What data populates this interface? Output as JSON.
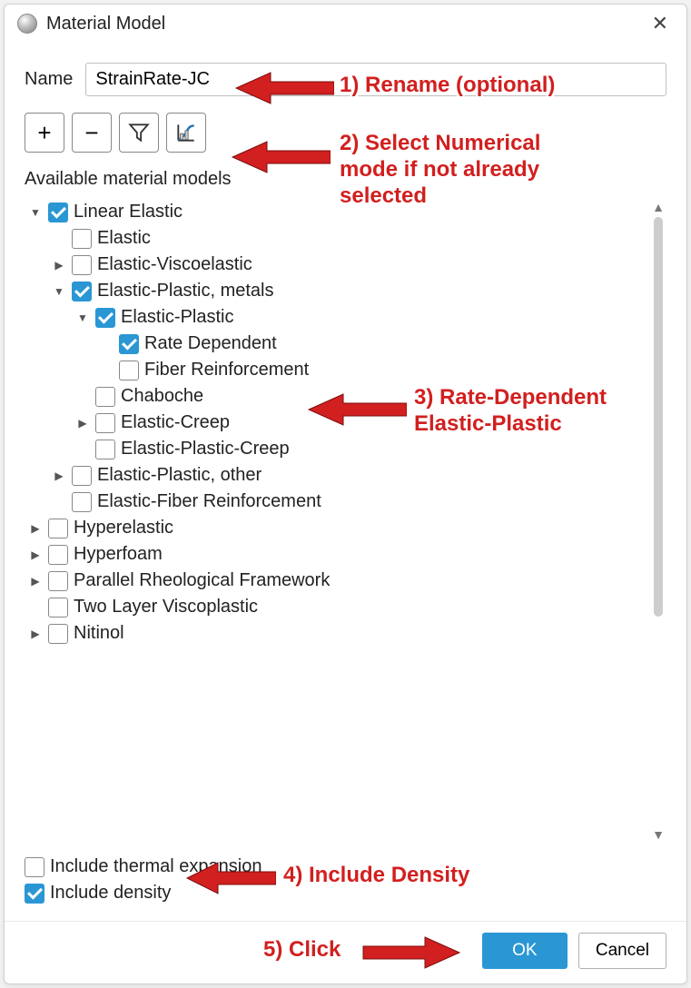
{
  "window": {
    "title": "Material Model",
    "close_icon": "close-icon"
  },
  "name_row": {
    "label": "Name",
    "value": "StrainRate-JC"
  },
  "toolbar": {
    "add": "+",
    "remove": "−",
    "filter_icon": "filter-icon",
    "chart_icon": "numerical-mode-icon"
  },
  "section_label": "Available material models",
  "tree": {
    "items": [
      {
        "d": 0,
        "caret": "down",
        "checked": true,
        "label": "Linear Elastic"
      },
      {
        "d": 1,
        "caret": null,
        "checked": false,
        "label": "Elastic"
      },
      {
        "d": 1,
        "caret": "right",
        "checked": false,
        "label": "Elastic-Viscoelastic"
      },
      {
        "d": 1,
        "caret": "down",
        "checked": true,
        "label": "Elastic-Plastic, metals"
      },
      {
        "d": 2,
        "caret": "down",
        "checked": true,
        "label": "Elastic-Plastic"
      },
      {
        "d": 3,
        "caret": null,
        "checked": true,
        "label": "Rate Dependent"
      },
      {
        "d": 3,
        "caret": null,
        "checked": false,
        "label": "Fiber Reinforcement"
      },
      {
        "d": 2,
        "caret": null,
        "checked": false,
        "label": "Chaboche"
      },
      {
        "d": 2,
        "caret": "right",
        "checked": false,
        "label": "Elastic-Creep"
      },
      {
        "d": 2,
        "caret": null,
        "checked": false,
        "label": "Elastic-Plastic-Creep"
      },
      {
        "d": 1,
        "caret": "right",
        "checked": false,
        "label": "Elastic-Plastic, other"
      },
      {
        "d": 1,
        "caret": null,
        "checked": false,
        "label": "Elastic-Fiber Reinforcement"
      },
      {
        "d": 0,
        "caret": "right",
        "checked": false,
        "label": "Hyperelastic"
      },
      {
        "d": 0,
        "caret": "right",
        "checked": false,
        "label": "Hyperfoam"
      },
      {
        "d": 0,
        "caret": "right",
        "checked": false,
        "label": "Parallel Rheological Framework"
      },
      {
        "d": 0,
        "caret": null,
        "checked": false,
        "label": "Two Layer Viscoplastic"
      },
      {
        "d": 0,
        "caret": "right",
        "checked": false,
        "label": "Nitinol"
      }
    ]
  },
  "bottom_checks": {
    "thermal": {
      "checked": false,
      "label": "Include thermal expansion"
    },
    "density": {
      "checked": true,
      "label": "Include density"
    }
  },
  "footer": {
    "ok": "OK",
    "cancel": "Cancel"
  },
  "annotations": {
    "a1": "1) Rename (optional)",
    "a2": "2) Select Numerical\nmode if not already\nselected",
    "a3": "3) Rate-Dependent\nElastic-Plastic",
    "a4": "4) Include Density",
    "a5": "5) Click"
  }
}
